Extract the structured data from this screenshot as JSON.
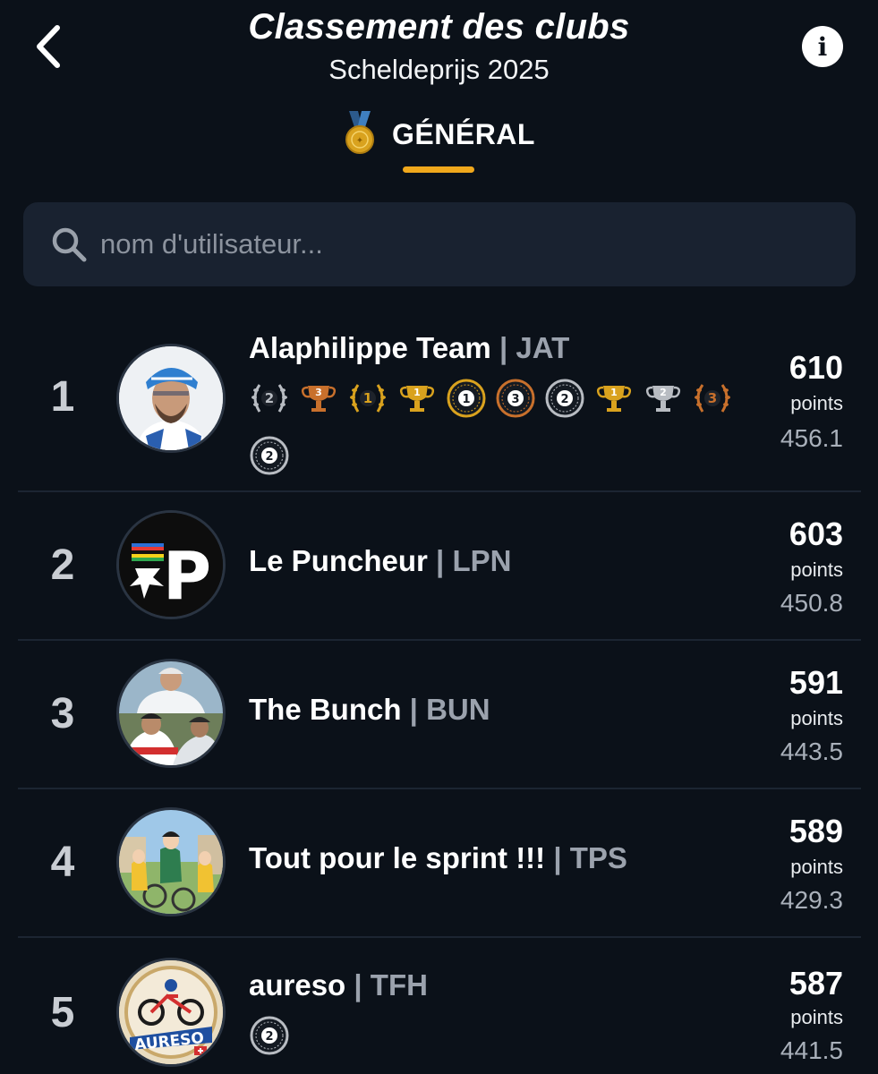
{
  "header": {
    "title": "Classement des clubs",
    "subtitle": "Scheldeprijs 2025",
    "back_icon": "chevron-left-icon",
    "info_icon": "info-icon",
    "info_glyph": "i"
  },
  "tab": {
    "label": "GÉNÉRAL",
    "icon": "medal-icon",
    "accent": "#f0a81c"
  },
  "search": {
    "placeholder": "nom d'utilisateur...",
    "value": "",
    "icon": "search-icon"
  },
  "colors": {
    "background": "#0b1119",
    "search_bg": "#192230",
    "gold": "#d9a21e",
    "silver": "#b8bcc2",
    "bronze": "#c8702c",
    "muted_text": "#9ba2ad"
  },
  "separator": "|",
  "points_label": "points",
  "rows": [
    {
      "rank": "1",
      "name": "Alaphilippe Team",
      "code": "JAT",
      "points": "610",
      "sub": "456.1",
      "avatar": "rider-portrait-avatar",
      "badges": [
        {
          "type": "laurel",
          "color": "silver",
          "num": "2"
        },
        {
          "type": "trophy",
          "color": "bronze",
          "num": "3"
        },
        {
          "type": "laurel",
          "color": "gold",
          "num": "1"
        },
        {
          "type": "trophy",
          "color": "gold",
          "num": "1"
        },
        {
          "type": "wheel",
          "color": "gold",
          "num": "1"
        },
        {
          "type": "wheel",
          "color": "bronze",
          "num": "3"
        },
        {
          "type": "wheel",
          "color": "silver",
          "num": "2"
        },
        {
          "type": "trophy",
          "color": "gold",
          "num": "1"
        },
        {
          "type": "trophy",
          "color": "silver",
          "num": "2"
        },
        {
          "type": "laurel",
          "color": "bronze",
          "num": "3"
        },
        {
          "type": "wheel",
          "color": "silver",
          "num": "2"
        }
      ]
    },
    {
      "rank": "2",
      "name": "Le Puncheur",
      "code": "LPN",
      "points": "603",
      "sub": "450.8",
      "avatar": "puncheur-logo-avatar",
      "logo_letter": "P",
      "badges": []
    },
    {
      "rank": "3",
      "name": "The Bunch",
      "code": "BUN",
      "points": "591",
      "sub": "443.5",
      "avatar": "riders-photo-avatar",
      "badges": []
    },
    {
      "rank": "4",
      "name": "Tout pour le sprint !!!",
      "code": "TPS",
      "points": "589",
      "sub": "429.3",
      "avatar": "anime-cyclists-avatar",
      "badges": []
    },
    {
      "rank": "5",
      "name": "aureso",
      "code": "TFH",
      "points": "587",
      "sub": "441.5",
      "avatar": "aureso-logo-avatar",
      "logo_text": "AURESO",
      "badges": [
        {
          "type": "wheel",
          "color": "silver",
          "num": "2"
        }
      ]
    }
  ]
}
